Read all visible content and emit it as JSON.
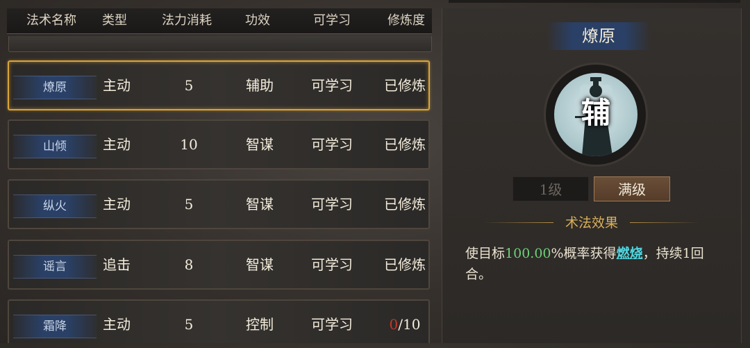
{
  "table": {
    "headers": [
      "法术名称",
      "类型",
      "法力消耗",
      "功效",
      "可学习",
      "修炼度"
    ],
    "rows": [
      {
        "name": "燎原",
        "type": "主动",
        "cost": "5",
        "effect": "辅助",
        "learn": "可学习",
        "progress": "已修炼",
        "selected": true
      },
      {
        "name": "山倾",
        "type": "主动",
        "cost": "10",
        "effect": "智谋",
        "learn": "可学习",
        "progress": "已修炼"
      },
      {
        "name": "纵火",
        "type": "主动",
        "cost": "5",
        "effect": "智谋",
        "learn": "可学习",
        "progress": "已修炼"
      },
      {
        "name": "谣言",
        "type": "追击",
        "cost": "8",
        "effect": "智谋",
        "learn": "可学习",
        "progress": "已修炼"
      },
      {
        "name": "霜降",
        "type": "主动",
        "cost": "5",
        "effect": "控制",
        "learn": "可学习",
        "progress_zero": "0",
        "progress_total": "/10"
      }
    ]
  },
  "detail": {
    "title": "燎原",
    "type_glyph": "辅",
    "level_1": "1级",
    "level_max": "满级",
    "effect_title": "术法效果",
    "effect_prefix": "使目标",
    "effect_rate": "100.00",
    "effect_mid": "%概率获得",
    "effect_status": "燃烧",
    "effect_suffix": "，持续1回合。"
  },
  "colors": {
    "selected_border": "#d9a43a",
    "accent_gold": "#d9b05a",
    "green": "#6fd17a",
    "cyan": "#4fd6e0",
    "zero_red": "#c0392b"
  }
}
